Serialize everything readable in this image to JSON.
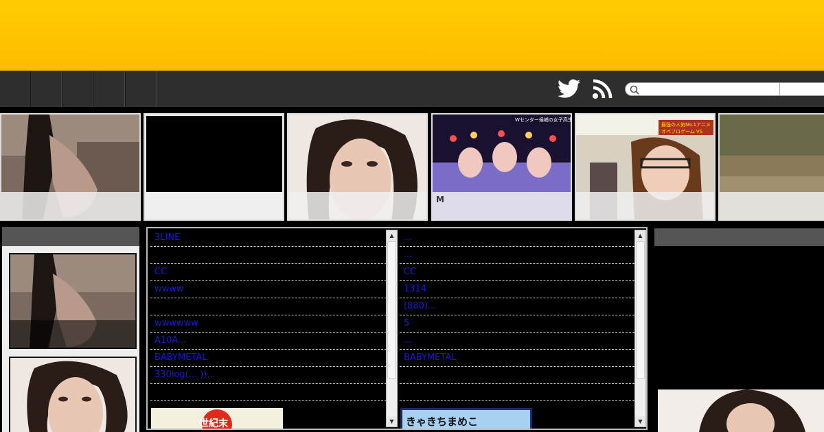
{
  "nav": {
    "tabs": [
      "",
      "",
      "",
      "",
      ""
    ],
    "search": {
      "placeholder": "",
      "value": ""
    },
    "icons": [
      "twitter-icon",
      "rss-icon",
      "search-icon"
    ]
  },
  "carousel": {
    "items": [
      {
        "caption": ""
      },
      {
        "caption": ""
      },
      {
        "caption": ""
      },
      {
        "caption": "M"
      },
      {
        "caption": ""
      },
      {
        "caption": ""
      }
    ],
    "overlay_text_4": "Wセンター候補の女子高生・オ",
    "overlay_text_5a": "最強の人気No.1アニメ",
    "overlay_text_5b": "オペフロゲーム VS"
  },
  "feed": {
    "left": [
      "3LINE",
      "",
      "CC",
      "wwww",
      "",
      "wwwwww",
      "A10A...",
      "BABYMETAL",
      "330log(... ))...",
      ""
    ],
    "right": [
      "...",
      "...",
      "CC",
      "1314",
      "(880)...",
      "5",
      "...",
      "BABYMETAL",
      "",
      ""
    ],
    "banner_left_text": "世紀末",
    "banner_right_text": "きゃきちまめこ"
  },
  "colors": {
    "header": "#ffcc00",
    "nav": "#2e2e2e",
    "link": "#1a1ad6"
  }
}
